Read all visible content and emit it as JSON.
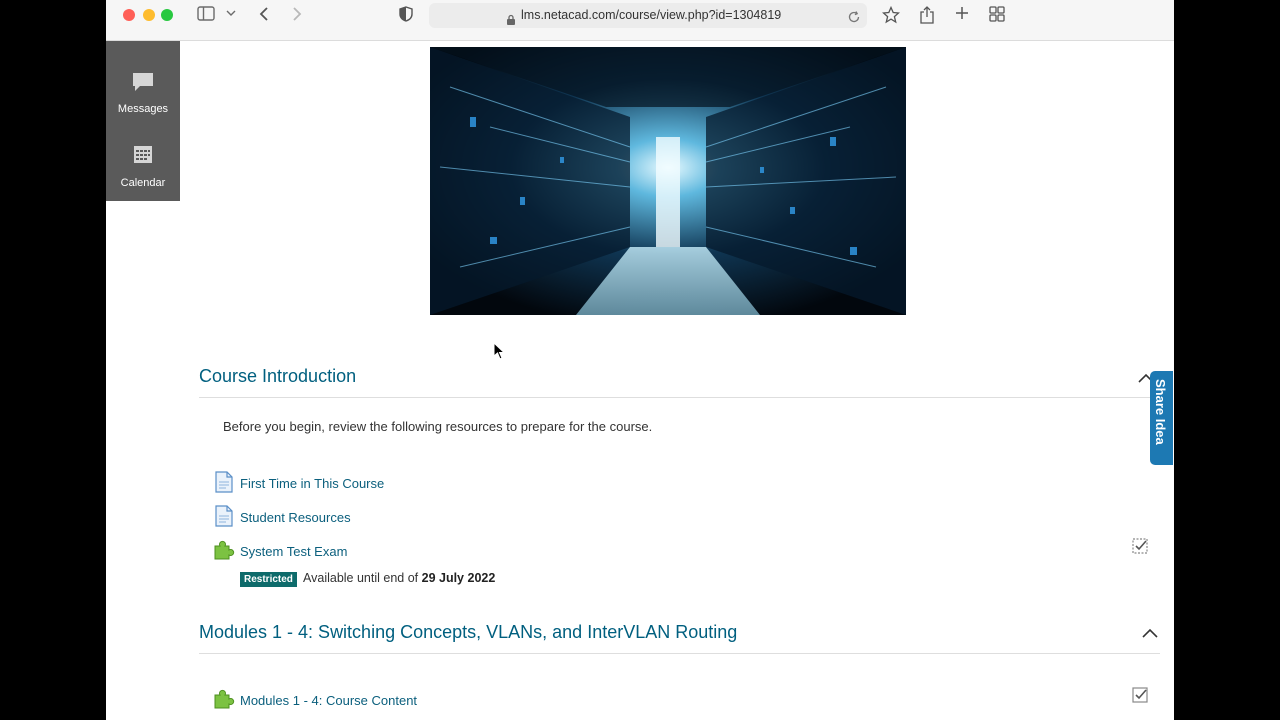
{
  "browser": {
    "url": "lms.netacad.com/course/view.php?id=1304819"
  },
  "dock": {
    "messages_label": "Messages",
    "calendar_label": "Calendar"
  },
  "course_intro": {
    "title": "Course Introduction",
    "description": "Before you begin, review the following resources to prepare for the course.",
    "activities": [
      {
        "label": "First Time in This Course",
        "icon": "page-icon"
      },
      {
        "label": "Student Resources",
        "icon": "page-icon"
      },
      {
        "label": "System Test Exam",
        "icon": "puzzle-icon"
      }
    ],
    "restriction_badge": "Restricted",
    "availability_prefix": "Available until end of",
    "availability_date": "29 July 2022"
  },
  "modules_section": {
    "title": "Modules 1 - 4: Switching Concepts, VLANs, and InterVLAN Routing",
    "activities": [
      {
        "label": "Modules 1 - 4: Course Content",
        "icon": "puzzle-icon"
      }
    ]
  },
  "share_idea": {
    "label": "Share Idea"
  },
  "colors": {
    "link": "#0b5f7d",
    "section_title": "#005f7f",
    "badge": "#0e6b6b",
    "share_tab": "#1d79b3"
  }
}
